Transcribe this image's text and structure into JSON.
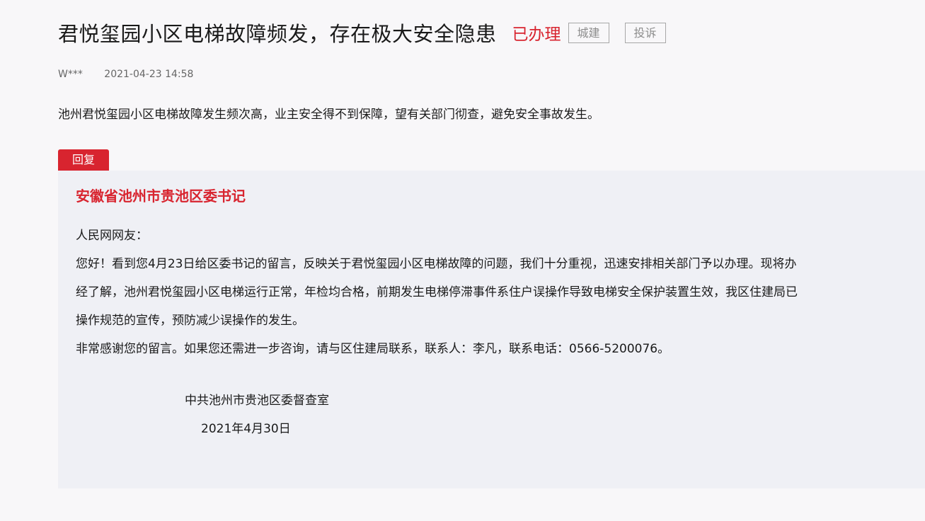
{
  "post": {
    "title": "君悦玺园小区电梯故障频发，存在极大安全隐患",
    "status": "已办理",
    "tags": [
      "城建",
      "投诉"
    ],
    "author": "W***",
    "datetime": "2021-04-23 14:58",
    "content": "池州君悦玺园小区电梯故障发生频次高，业主安全得不到保障，望有关部门彻查，避免安全事故发生。"
  },
  "reply": {
    "tab_label": "回复",
    "responder": "安徽省池州市贵池区委书记",
    "lines": [
      "人民网网友：",
      "您好！看到您4月23日给区委书记的留言，反映关于君悦玺园小区电梯故障的问题，我们十分重视，迅速安排相关部门予以办理。现将办",
      "经了解，池州君悦玺园小区电梯运行正常，年检均合格，前期发生电梯停滞事件系住户误操作导致电梯安全保护装置生效，我区住建局已",
      "操作规范的宣传，预防减少误操作的发生。",
      "非常感谢您的留言。如果您还需进一步咨询，请与区住建局联系，联系人：李凡，联系电话：0566-5200076。"
    ],
    "sign_org": "中共池州市贵池区委督查室",
    "sign_date": "2021年4月30日"
  },
  "colors": {
    "accent_red": "#d8242f",
    "reply_bg": "#eff0f5",
    "page_bg": "#f8f7f9"
  }
}
